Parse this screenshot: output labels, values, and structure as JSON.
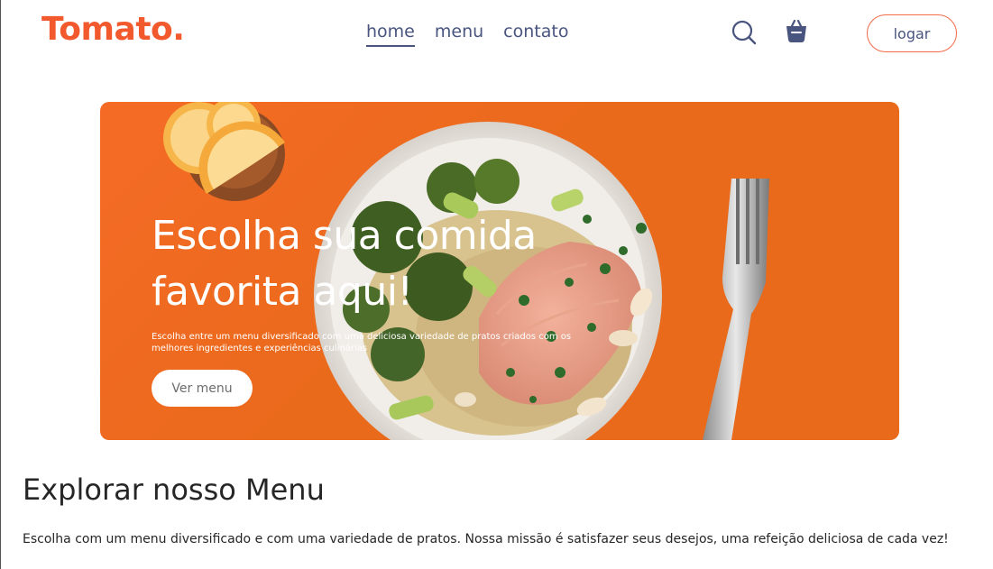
{
  "header": {
    "logo": "Tomato.",
    "nav": [
      {
        "label": "home",
        "active": true
      },
      {
        "label": "menu",
        "active": false
      },
      {
        "label": "contato",
        "active": false
      }
    ],
    "icons": [
      "search-icon",
      "basket-icon"
    ],
    "login_label": "logar"
  },
  "hero": {
    "title": "Escolha sua comida favorita aqui!",
    "subtitle": "Escolha entre um menu diversificado com uma deliciosa variedade de pratos criados com os melhores ingredientes e experiências culinárias",
    "button_label": "Ver menu"
  },
  "explore": {
    "title": "Explorar nosso Menu",
    "text": "Escolha com um menu diversificado e com uma variedade de pratos. Nossa missão é satisfazer seus desejos, uma refeição deliciosa de cada vez!"
  },
  "colors": {
    "brand": "#f25a2e",
    "nav_text": "#49557e",
    "hero_bg": "#ea6a1c"
  }
}
